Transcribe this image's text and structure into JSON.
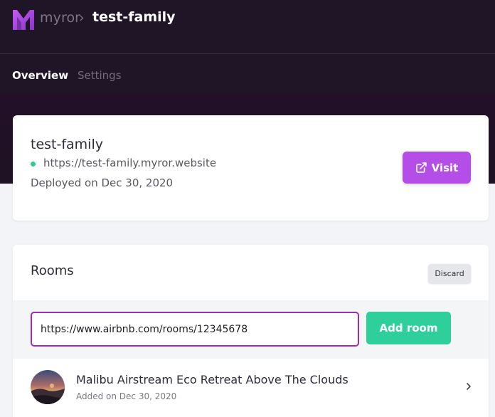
{
  "header": {
    "brand": "myror",
    "separator": "›",
    "site_title": "test-family"
  },
  "tabs": [
    {
      "label": "Overview",
      "active": true
    },
    {
      "label": "Settings",
      "active": false
    }
  ],
  "site": {
    "name": "test-family",
    "url": "https://test-family.myror.website",
    "status_color": "#2ecc8f",
    "deployed": "Deployed on Dec 30, 2020",
    "visit_label": "Visit",
    "visit_icon": "external-link-icon"
  },
  "rooms": {
    "title": "Rooms",
    "discard_label": "Discard",
    "input_value": "https://www.airbnb.com/rooms/12345678",
    "add_label": "Add room",
    "items": [
      {
        "name": "Malibu Airstream Eco Retreat Above The Clouds",
        "added": "Added on Dec 30, 2020"
      }
    ]
  },
  "colors": {
    "header_bg": "#201427",
    "visit_button": "#b54ee8",
    "add_button": "#2fcf9b",
    "input_border": "#a02ac0"
  }
}
